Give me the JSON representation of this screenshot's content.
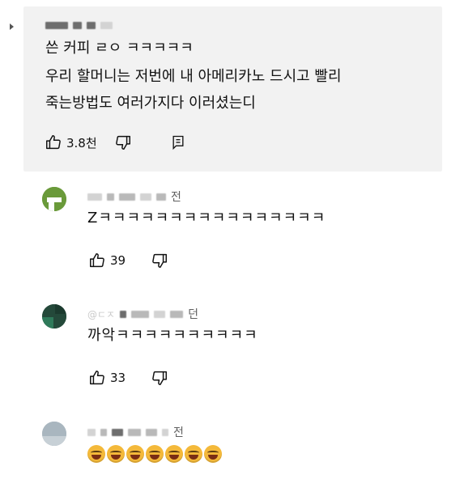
{
  "comments": [
    {
      "text_lines": [
        "쓴 커피 ㄹㅇ ㅋㅋㅋㅋㅋ",
        "우리 할머니는 저번에 내 아메리카노 드시고 빨리",
        "죽는방법도 여러가지다 이러셨는디"
      ],
      "likes": "3.8천"
    },
    {
      "author_fragment": "전",
      "text": "Zㅋㅋㅋㅋㅋㅋㅋㅋㅋㅋㅋㅋㅋㅋㅋㅋ",
      "likes": "39"
    },
    {
      "author_fragment": "@ㄷㅈ",
      "author_suffix": "던",
      "text": "까악ㅋㅋㅋㅋㅋㅋㅋㅋㅋㅋ",
      "likes": "33"
    },
    {
      "author_fragment": "전",
      "emoji_count": 7
    }
  ],
  "icons": {
    "like": "thumbs-up-icon",
    "dislike": "thumbs-down-icon",
    "reply": "reply-icon"
  },
  "colors": {
    "card_background": "#f2f2f2",
    "avatar_green": "#6a9a3a",
    "avatar_dark_green": "#24493a",
    "avatar_gray": "#a9b6bf"
  }
}
